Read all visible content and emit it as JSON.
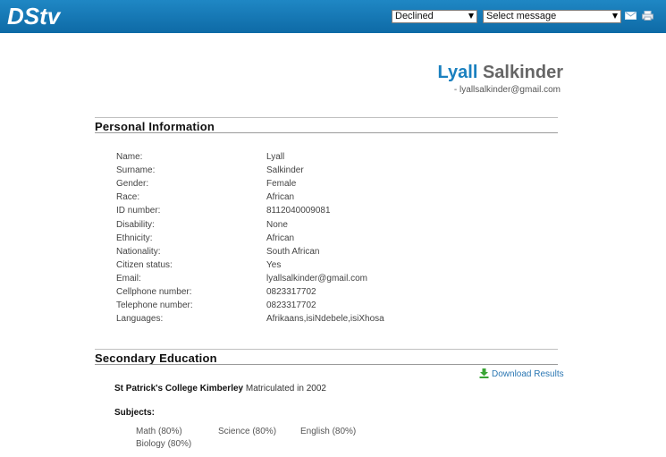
{
  "header": {
    "logo_text": "DStv",
    "status_select": "Declined",
    "message_select": "Select message",
    "mail_icon": "mail-icon",
    "print_icon": "printer-icon"
  },
  "profile": {
    "first_name": "Lyall",
    "last_name": "Salkinder",
    "email_line": "- lyallsalkinder@gmail.com"
  },
  "personal": {
    "title": "Personal Information",
    "rows": [
      {
        "label": "Name:",
        "value": "Lyall"
      },
      {
        "label": "Surname:",
        "value": "Salkinder"
      },
      {
        "label": "Gender:",
        "value": "Female"
      },
      {
        "label": "Race:",
        "value": "African"
      },
      {
        "label": "ID number:",
        "value": "8112040009081"
      },
      {
        "label": "Disability:",
        "value": "None"
      },
      {
        "label": "Ethnicity:",
        "value": "African"
      },
      {
        "label": "Nationality:",
        "value": "South African"
      },
      {
        "label": "Citizen status:",
        "value": "Yes"
      },
      {
        "label": "Email:",
        "value": "lyallsalkinder@gmail.com"
      },
      {
        "label": "Cellphone number:",
        "value": "0823317702"
      },
      {
        "label": "Telephone number:",
        "value": "0823317702"
      },
      {
        "label": "Languages:",
        "value": "Afrikaans,isiNdebele,isiXhosa"
      }
    ]
  },
  "secondary": {
    "title": "Secondary Education",
    "download_label": "Download Results",
    "school_name": "St Patrick's College Kimberley",
    "school_detail": " Matriculated in 2002",
    "subjects_heading": "Subjects:",
    "subjects": [
      "Math (80%)",
      "Science (80%)",
      "English (80%)",
      "Biology (80%)"
    ]
  }
}
